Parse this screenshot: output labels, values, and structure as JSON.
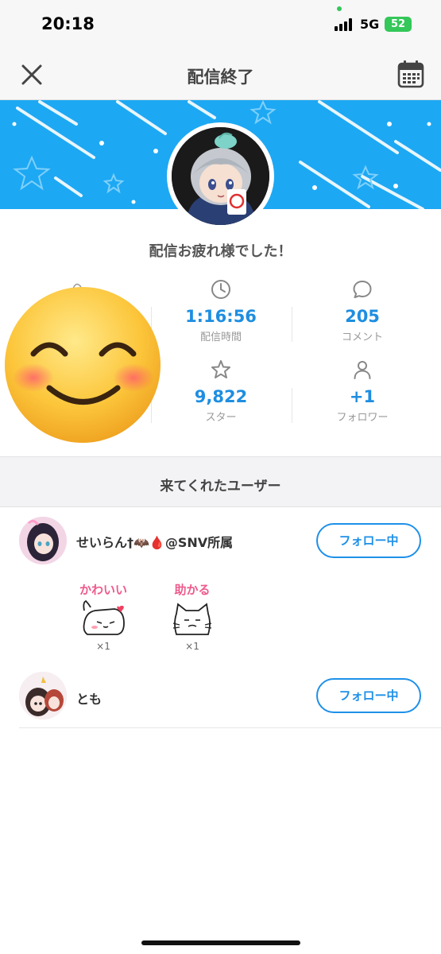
{
  "status_bar": {
    "time": "20:18",
    "network": "5G",
    "battery": "52"
  },
  "header": {
    "title": "配信終了"
  },
  "summary": {
    "headline": "配信お疲れ様でした！",
    "stats": [
      {
        "icon": "clock-icon",
        "value": "1:16:56",
        "label": "配信時間"
      },
      {
        "icon": "comment-icon",
        "value": "205",
        "label": "コメント"
      },
      {
        "icon": "star-icon",
        "value": "9,822",
        "label": "スター"
      },
      {
        "icon": "person-icon",
        "value": "+1",
        "label": "フォロワー"
      }
    ]
  },
  "visitors": {
    "title": "来てくれたユーザー",
    "users": [
      {
        "name": "せいらん†🦇🩸@SNV所属",
        "follow_label": "フォロー中",
        "stickers": [
          {
            "text": "かわいい",
            "count": "×1"
          },
          {
            "text": "助かる",
            "count": "×1"
          }
        ]
      },
      {
        "name": "とも",
        "follow_label": "フォロー中"
      }
    ]
  },
  "colors": {
    "accent": "#1e90e8",
    "banner": "#1da8f3",
    "sticker_text": "#ee5a8c"
  }
}
